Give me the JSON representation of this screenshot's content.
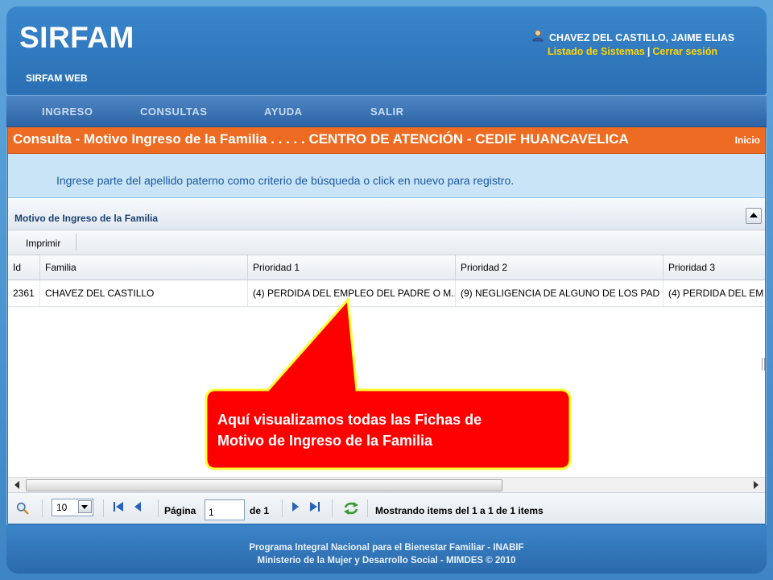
{
  "header": {
    "logo": "SIRFAM",
    "subtitle": "SIRFAM WEB",
    "user_name": "CHAVEZ DEL CASTILLO, JAIME ELIAS",
    "link_systems": "Listado de Sistemas",
    "link_sep": "|",
    "link_logout": "Cerrar sesión",
    "icons": {
      "user": "user-icon"
    }
  },
  "nav": {
    "items": [
      {
        "label": "INGRESO"
      },
      {
        "label": "CONSULTAS"
      },
      {
        "label": "AYUDA"
      },
      {
        "label": "SALIR"
      }
    ]
  },
  "page": {
    "title": "Consulta - Motivo Ingreso de la Familia . . . . . CENTRO DE ATENCIÓN - CEDIF HUANCAVELICA",
    "home_link": "Inicio",
    "info": "Ingrese parte del apellido paterno como criterio de búsqueda o click en nuevo para registro."
  },
  "panel": {
    "title": "Motivo de Ingreso de la Familia",
    "toolbar_print": "Imprimir"
  },
  "grid": {
    "columns": [
      "Id",
      "Familia",
      "Prioridad 1",
      "Prioridad 2",
      "Prioridad 3"
    ],
    "rows": [
      [
        "2361",
        "CHAVEZ DEL CASTILLO",
        "(4) PERDIDA DEL EMPLEO DEL PADRE O M...",
        "(9) NEGLIGENCIA DE ALGUNO DE LOS PAD",
        "(4) PERDIDA DEL EM"
      ]
    ]
  },
  "pager": {
    "page_size": "10",
    "page_label": "Página",
    "page_value": "1",
    "page_of": "de 1",
    "status": "Mostrando items del 1 a 1 de 1 items",
    "icons": [
      "search-icon",
      "first-page-icon",
      "prev-page-icon",
      "next-page-icon",
      "last-page-icon",
      "refresh-icon"
    ]
  },
  "callout": {
    "line1": "Aquí visualizamos todas las Fichas de",
    "line2": "Motivo de Ingreso  de la  Familia",
    "fill": "#ff0000",
    "border": "#ffff33"
  },
  "footer": {
    "line1": "Programa Integral Nacional para el Bienestar Familiar - INABIF",
    "line2": "Ministerio de la Mujer y Desarrollo Social - MIMDES © 2010"
  },
  "colors": {
    "title_bar": "#ee6b22",
    "info_bg": "#c8e4f6",
    "link": "#ffd400"
  }
}
